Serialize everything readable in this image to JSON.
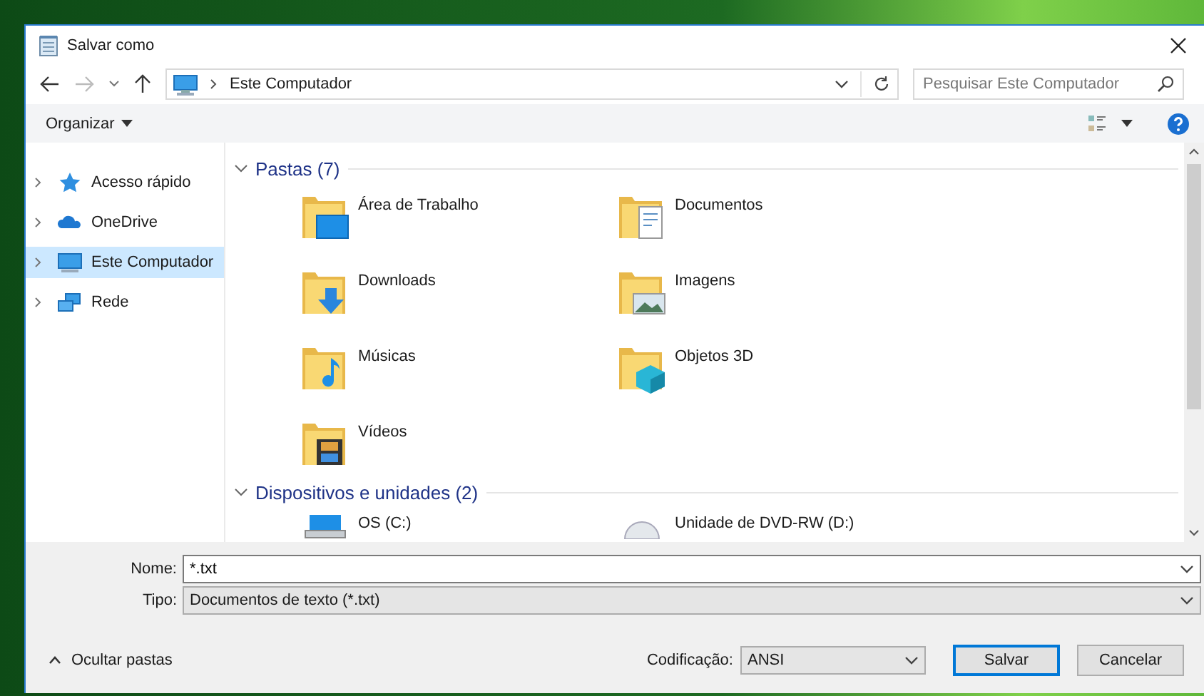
{
  "window": {
    "title": "Salvar como"
  },
  "address": {
    "path": "Este Computador"
  },
  "search": {
    "placeholder": "Pesquisar Este Computador"
  },
  "toolbar": {
    "organize": "Organizar"
  },
  "sidebar": {
    "items": [
      {
        "label": "Acesso rápido",
        "kind": "star",
        "selected": false
      },
      {
        "label": "OneDrive",
        "kind": "cloud",
        "selected": false
      },
      {
        "label": "Este Computador",
        "kind": "pc",
        "selected": true
      },
      {
        "label": "Rede",
        "kind": "network",
        "selected": false
      }
    ]
  },
  "sections": [
    {
      "title": "Pastas (7)",
      "expanded": true,
      "items": [
        {
          "label": "Área de Trabalho",
          "kind": "desktop"
        },
        {
          "label": "Documentos",
          "kind": "documents"
        },
        {
          "label": "Downloads",
          "kind": "downloads"
        },
        {
          "label": "Imagens",
          "kind": "pictures"
        },
        {
          "label": "Músicas",
          "kind": "music"
        },
        {
          "label": "Objetos 3D",
          "kind": "objects3d"
        },
        {
          "label": "Vídeos",
          "kind": "videos"
        }
      ]
    },
    {
      "title": "Dispositivos e unidades (2)",
      "expanded": true,
      "items": [
        {
          "label": "OS (C:)",
          "kind": "drive"
        },
        {
          "label": "Unidade de DVD-RW (D:)",
          "kind": "dvd"
        }
      ]
    }
  ],
  "footer": {
    "name_label": "Nome:",
    "name_value": "*.txt",
    "type_label": "Tipo:",
    "type_value": "Documentos de texto (*.txt)",
    "hide_folders": "Ocultar pastas",
    "encoding_label": "Codificação:",
    "encoding_value": "ANSI",
    "buttons": [
      {
        "label": "Salvar",
        "default": true
      },
      {
        "label": "Cancelar",
        "default": false
      }
    ]
  }
}
